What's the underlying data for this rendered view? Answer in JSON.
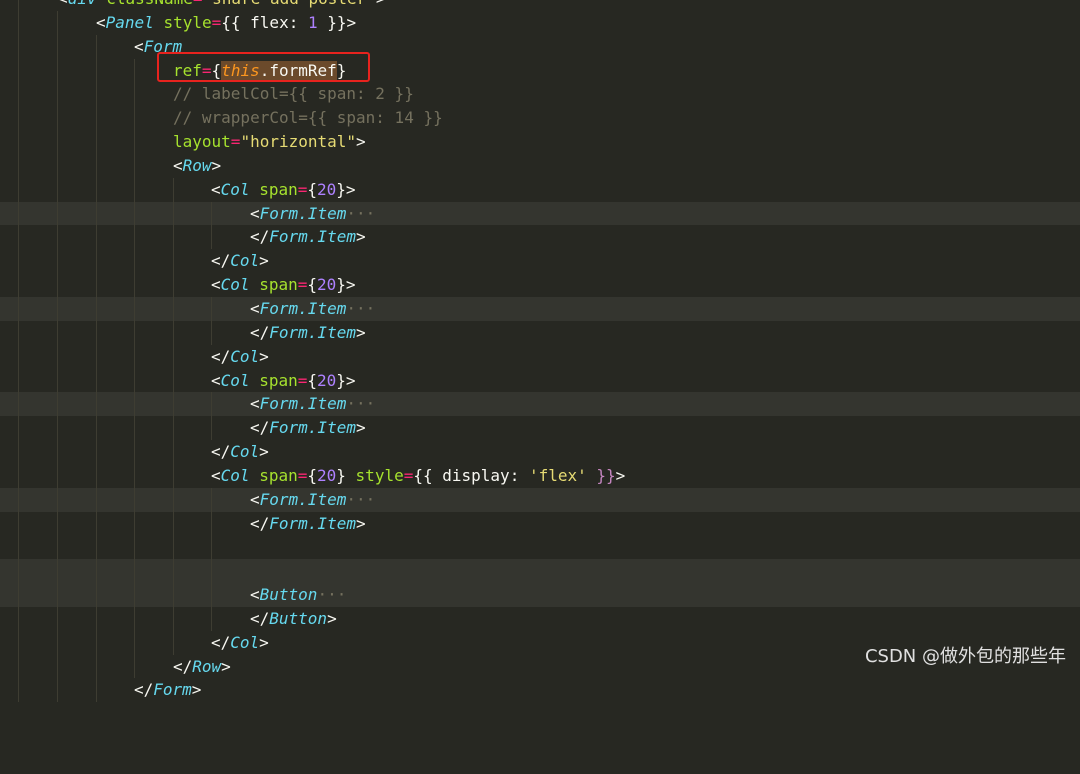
{
  "code_lines": [
    "<div className=\"share-add-poster\">",
    "<Panel style={{ flex: 1 }}>",
    "<Form",
    "ref={this.formRef}",
    "// labelCol={{ span: 2 }}",
    "// wrapperCol={{ span: 14 }}",
    "layout=\"horizontal\">",
    "<Row>",
    "<Col span={20}>",
    "<Form.Item ···",
    "</Form.Item>",
    "</Col>",
    "<Col span={20}>",
    "<Form.Item ···",
    "</Form.Item>",
    "</Col>",
    "<Col span={20}>",
    "<Form.Item ···",
    "</Form.Item>",
    "</Col>",
    "<Col span={20} style={{ display: 'flex' }}>",
    "<Form.Item ···",
    "</Form.Item>",
    "",
    "",
    "<Button ···",
    "</Button>",
    "</Col>",
    "</Row>",
    "</Form>"
  ],
  "watermark": "CSDN @做外包的那些年",
  "colors": {
    "background": "#272822",
    "tag": "#66d9ef",
    "attribute": "#a6e22e",
    "string": "#e6db74",
    "number": "#ae81ff",
    "comment": "#75715e",
    "keyword": "#fd971f",
    "highlight_box": "#e8231e"
  }
}
